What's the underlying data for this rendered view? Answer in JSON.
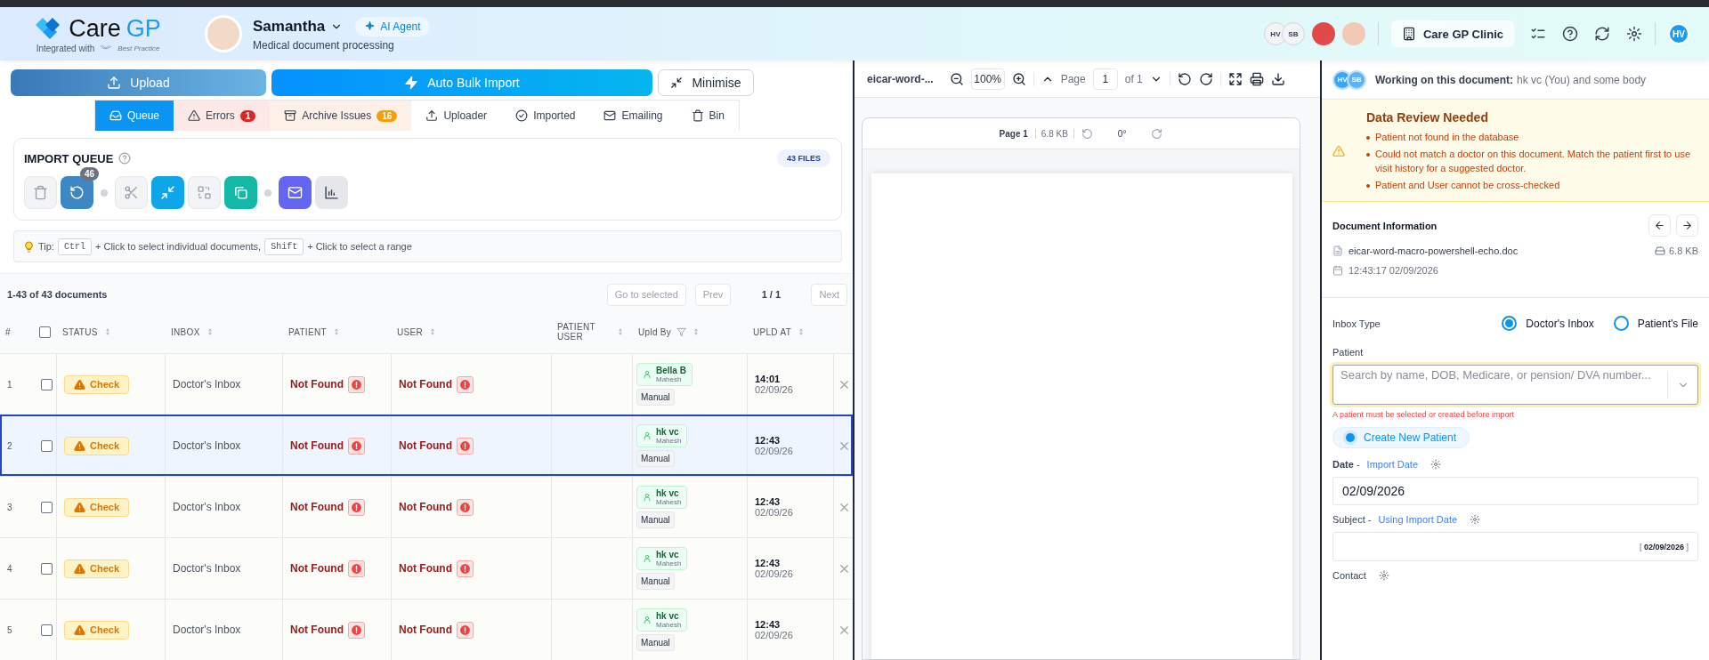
{
  "header": {
    "brand_care": "Care",
    "brand_gp": "GP",
    "integrated": "Integrated with",
    "partner": "Best Practice",
    "agent_name": "Samantha",
    "agent_badge": "AI Agent",
    "agent_desc": "Medical document processing",
    "presence": [
      "HV",
      "SB"
    ],
    "clinic": "Care GP Clinic",
    "user_initials": "HV"
  },
  "actions": [
    {
      "kind": "upload",
      "label": "Upload"
    },
    {
      "kind": "bulk",
      "label": "Auto Bulk Import"
    },
    {
      "kind": "minimise",
      "label": "Minimise"
    }
  ],
  "tabs": [
    {
      "kind": "queue",
      "label": "Queue",
      "selected": true
    },
    {
      "kind": "errors",
      "label": "Errors",
      "count": "1",
      "selected": false
    },
    {
      "kind": "archive",
      "label": "Archive Issues",
      "count": "16",
      "selected": false
    },
    {
      "kind": "uploader",
      "label": "Uploader",
      "selected": false
    },
    {
      "kind": "imported",
      "label": "Imported",
      "selected": false
    },
    {
      "kind": "emailing",
      "label": "Emailing",
      "selected": false
    },
    {
      "kind": "bin",
      "label": "Bin",
      "selected": false
    }
  ],
  "import_queue": {
    "title": "IMPORT QUEUE",
    "files": "43 FILES",
    "tools": [
      {
        "kind": "delete",
        "disabled": true
      },
      {
        "kind": "retry",
        "disabled": false,
        "color": "#3d87c4",
        "badge": "46"
      },
      {
        "kind": "dot"
      },
      {
        "kind": "split",
        "disabled": true
      },
      {
        "kind": "merge",
        "disabled": false,
        "color": "#0ea5e9"
      },
      {
        "kind": "scan",
        "disabled": true
      },
      {
        "kind": "copy",
        "disabled": false,
        "color": "#14b8a6"
      },
      {
        "kind": "dot"
      },
      {
        "kind": "mail",
        "disabled": false,
        "color": "#6366f1"
      },
      {
        "kind": "chart",
        "disabled": false,
        "color": "#e5e7eb"
      }
    ]
  },
  "tip": [
    {
      "kind": "label",
      "text": "Tip:"
    },
    {
      "kind": "key",
      "text": "Ctrl"
    },
    {
      "kind": "text",
      "text": "+ Click to select individual documents,"
    },
    {
      "kind": "key",
      "text": "Shift"
    },
    {
      "kind": "text",
      "text": "+ Click to select a range"
    }
  ],
  "table": {
    "select_all": false,
    "summary": "1-43 of 43 documents",
    "go_selected": "Go to selected",
    "prev": "Prev",
    "page": "1 / 1",
    "next": "Next",
    "columns": [
      "#",
      "STATUS",
      "INBOX",
      "PATIENT",
      "USER",
      "PATIENT USER",
      "Upld By",
      "UPLD AT"
    ],
    "rows": [
      {
        "num": "1",
        "checked": false,
        "selected": false,
        "status": "Check",
        "inbox": "Doctor's Inbox",
        "patient": "Not Found",
        "user": "Not Found",
        "uploader": "Bella B",
        "uploader_sub": "Mahesh",
        "method": "Manual",
        "time": "14:01",
        "date": "02/09/26"
      },
      {
        "num": "2",
        "checked": false,
        "selected": true,
        "status": "Check",
        "inbox": "Doctor's Inbox",
        "patient": "Not Found",
        "user": "Not Found",
        "uploader": "hk vc",
        "uploader_sub": "Mahesh",
        "method": "Manual",
        "time": "12:43",
        "date": "02/09/26"
      },
      {
        "num": "3",
        "checked": false,
        "selected": false,
        "status": "Check",
        "inbox": "Doctor's Inbox",
        "patient": "Not Found",
        "user": "Not Found",
        "uploader": "hk vc",
        "uploader_sub": "Mahesh",
        "method": "Manual",
        "time": "12:43",
        "date": "02/09/26"
      },
      {
        "num": "4",
        "checked": false,
        "selected": false,
        "status": "Check",
        "inbox": "Doctor's Inbox",
        "patient": "Not Found",
        "user": "Not Found",
        "uploader": "hk vc",
        "uploader_sub": "Mahesh",
        "method": "Manual",
        "time": "12:43",
        "date": "02/09/26"
      },
      {
        "num": "5",
        "checked": false,
        "selected": false,
        "status": "Check",
        "inbox": "Doctor's Inbox",
        "patient": "Not Found",
        "user": "Not Found",
        "uploader": "hk vc",
        "uploader_sub": "Mahesh",
        "method": "Manual",
        "time": "12:43",
        "date": "02/09/26"
      }
    ]
  },
  "viewer": {
    "filename": "eicar-word-...",
    "zoom": "100%",
    "page_label": "Page",
    "page": "1",
    "page_of": "of 1",
    "card_title": "Page 1",
    "card_size": "6.8 KB",
    "rotation": "0°"
  },
  "side": {
    "working_label": "Working on this document:",
    "working_names": "hk vc (You) and some body",
    "working_avatars": [
      "HV",
      "SB"
    ],
    "review_title": "Data Review Needed",
    "review_items": [
      "Patient not found in the database",
      "Could not match a doctor on this document. Match the patient first to use visit history for a suggested doctor.",
      "Patient and User cannot be cross-checked"
    ],
    "doc_title": "Document Information",
    "doc_filename": "eicar-word-macro-powershell-echo.doc",
    "doc_size": "6.8 KB",
    "doc_timestamp": "12:43:17 02/09/2026",
    "inbox_label": "Inbox Type",
    "inbox_options": [
      {
        "label": "Doctor's Inbox",
        "selected": true
      },
      {
        "label": "Patient's File",
        "selected": false
      }
    ],
    "patient_label": "Patient",
    "patient_placeholder": "Search by name, DOB, Medicare, or pension/ DVA number...",
    "patient_error": "A patient must be selected or created before import",
    "create_patient": "Create New Patient",
    "date_label": "**Date** -",
    "date_link": "Import Date",
    "date_value": "02/09/2026",
    "subject_label": "Subject -",
    "subject_link": "Using Import Date",
    "subject_hint": "[ **02/09/2026** ]",
    "contact_label": "Contact"
  }
}
